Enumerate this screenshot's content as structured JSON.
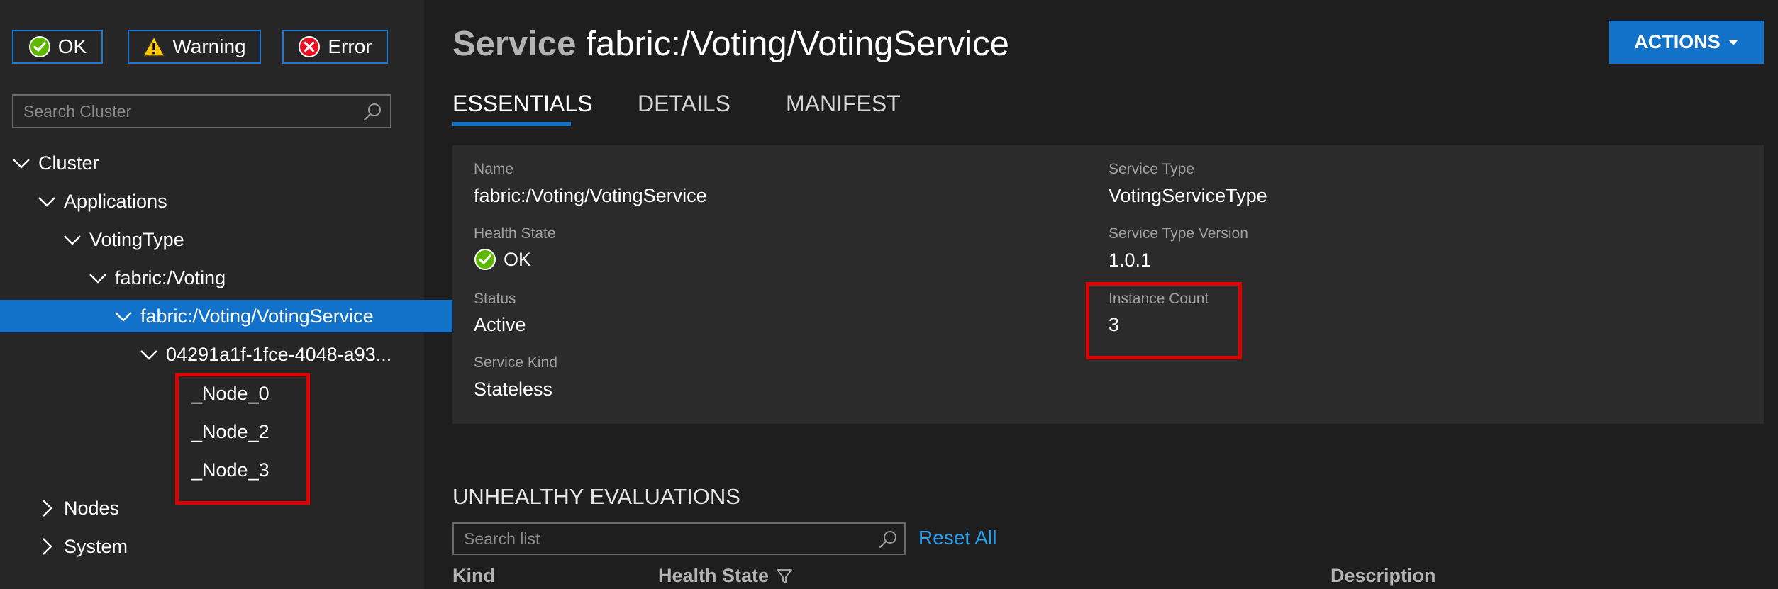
{
  "filters": {
    "ok_label": "OK",
    "warning_label": "Warning",
    "error_label": "Error"
  },
  "sidebar": {
    "search_placeholder": "Search Cluster",
    "tree": {
      "cluster": "Cluster",
      "applications": "Applications",
      "voting_type": "VotingType",
      "voting_app": "fabric:/Voting",
      "voting_service": "fabric:/Voting/VotingService",
      "partition": "04291a1f-1fce-4048-a93...",
      "node_0": "_Node_0",
      "node_2": "_Node_2",
      "node_3": "_Node_3",
      "nodes": "Nodes",
      "system": "System"
    }
  },
  "header": {
    "kind": "Service",
    "name": "fabric:/Voting/VotingService",
    "actions_label": "ACTIONS"
  },
  "tabs": {
    "essentials": "ESSENTIALS",
    "details": "DETAILS",
    "manifest": "MANIFEST"
  },
  "essentials": {
    "name_label": "Name",
    "name_value": "fabric:/Voting/VotingService",
    "health_label": "Health State",
    "health_value": "OK",
    "status_label": "Status",
    "status_value": "Active",
    "kind_label": "Service Kind",
    "kind_value": "Stateless",
    "type_label": "Service Type",
    "type_value": "VotingServiceType",
    "version_label": "Service Type Version",
    "version_value": "1.0.1",
    "instance_label": "Instance Count",
    "instance_value": "3"
  },
  "unhealthy": {
    "title": "UNHEALTHY EVALUATIONS",
    "search_placeholder": "Search list",
    "reset_label": "Reset All",
    "columns": {
      "kind": "Kind",
      "health_state": "Health State",
      "description": "Description"
    }
  },
  "colors": {
    "accent": "#1272c9",
    "highlight": "#e00000",
    "ok_green": "#5fb800",
    "warning_yellow": "#ffc800",
    "error_red": "#e81123",
    "link": "#2aa0f0"
  }
}
